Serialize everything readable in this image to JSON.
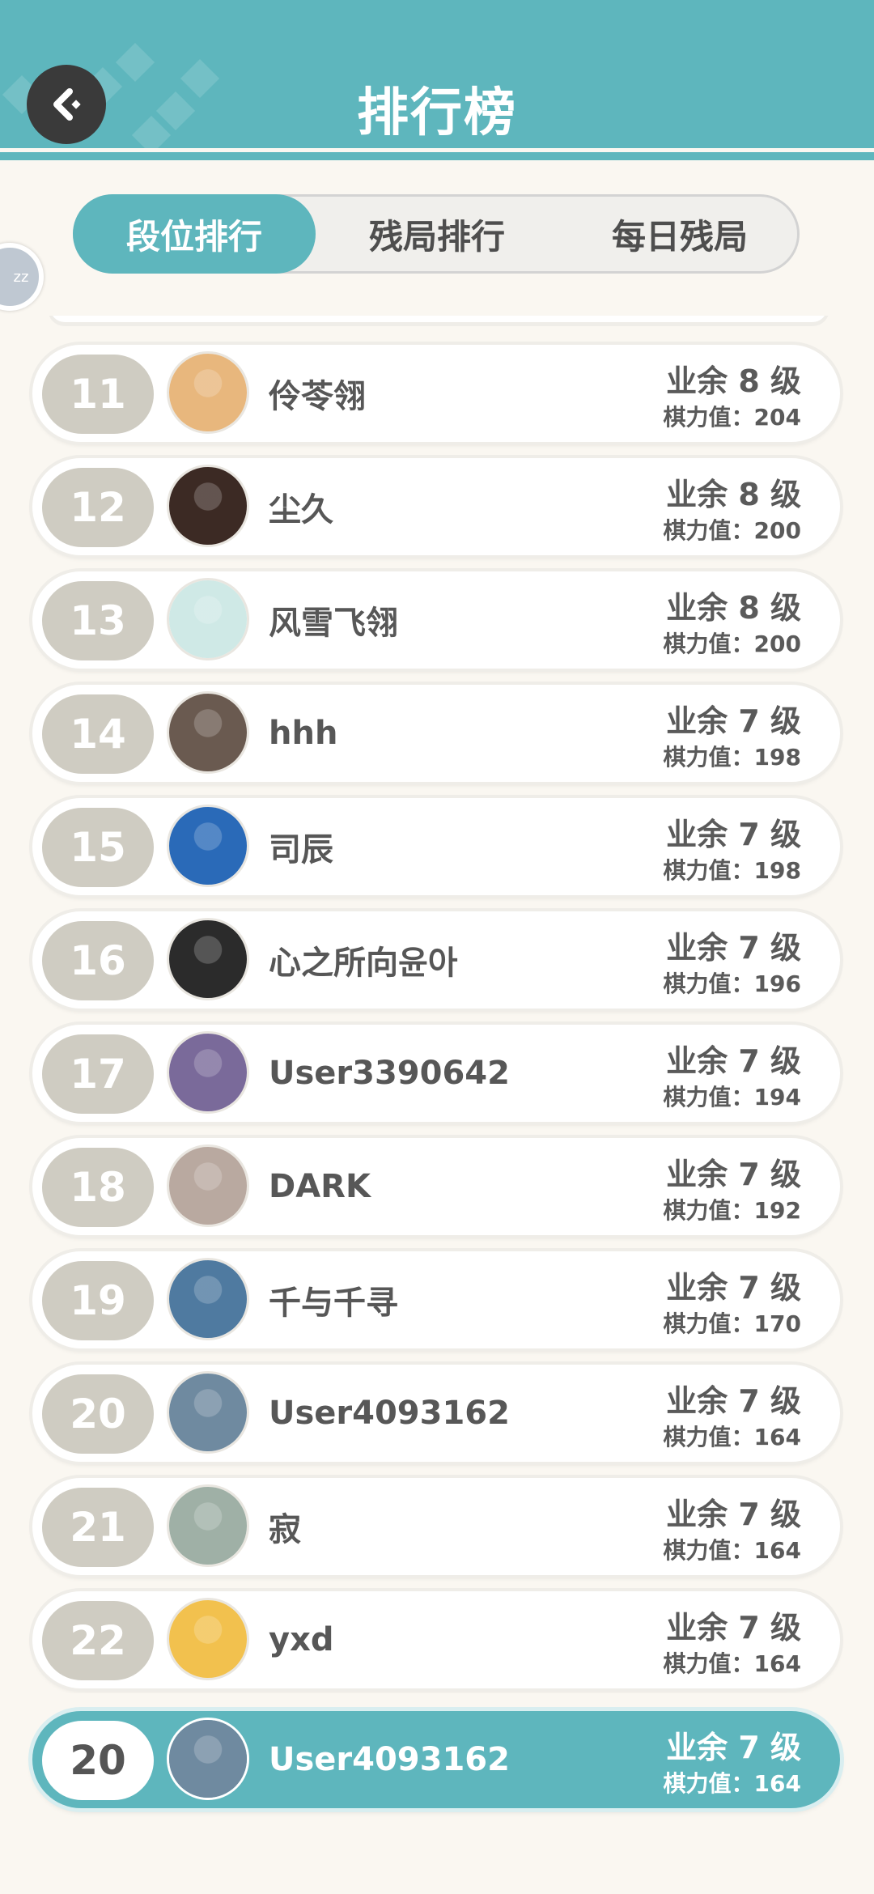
{
  "header": {
    "title": "排行榜"
  },
  "tabs": [
    {
      "label": "段位排行",
      "active": true
    },
    {
      "label": "残局排行",
      "active": false
    },
    {
      "label": "每日残局",
      "active": false
    }
  ],
  "side_bubble": {
    "text": "zz"
  },
  "list": [
    {
      "rank": "11",
      "name": "伶苓翎",
      "level": "业余 8 级",
      "power": "棋力值：204",
      "avatar_color": "#e8b77d"
    },
    {
      "rank": "12",
      "name": "尘久",
      "level": "业余 8 级",
      "power": "棋力值：200",
      "avatar_color": "#3c2a24"
    },
    {
      "rank": "13",
      "name": "风雪飞翎",
      "level": "业余 8 级",
      "power": "棋力值：200",
      "avatar_color": "#cfe9e6"
    },
    {
      "rank": "14",
      "name": "hhh",
      "level": "业余 7 级",
      "power": "棋力值：198",
      "avatar_color": "#6a5a50"
    },
    {
      "rank": "15",
      "name": "司辰",
      "level": "业余 7 级",
      "power": "棋力值：198",
      "avatar_color": "#2a6ab8"
    },
    {
      "rank": "16",
      "name": "心之所向윤아",
      "level": "业余 7 级",
      "power": "棋力值：196",
      "avatar_color": "#2b2b2b"
    },
    {
      "rank": "17",
      "name": "User3390642",
      "level": "业余 7 级",
      "power": "棋力值：194",
      "avatar_color": "#7a6a9a"
    },
    {
      "rank": "18",
      "name": "DARK",
      "level": "业余 7 级",
      "power": "棋力值：192",
      "avatar_color": "#b9a9a0"
    },
    {
      "rank": "19",
      "name": "千与千寻",
      "level": "业余 7 级",
      "power": "棋力值：170",
      "avatar_color": "#4f7aa0"
    },
    {
      "rank": "20",
      "name": "User4093162",
      "level": "业余 7 级",
      "power": "棋力值：164",
      "avatar_color": "#6f8aa0"
    },
    {
      "rank": "21",
      "name": "寂",
      "level": "业余 7 级",
      "power": "棋力值：164",
      "avatar_color": "#9fb0a6"
    },
    {
      "rank": "22",
      "name": "yxd",
      "level": "业余 7 级",
      "power": "棋力值：164",
      "avatar_color": "#f2c14e"
    }
  ],
  "self": {
    "rank": "20",
    "name": "User4093162",
    "level": "业余 7 级",
    "power": "棋力值：164",
    "avatar_color": "#6f8aa0"
  },
  "colors": {
    "accent": "#5eb6bd",
    "rank_badge": "#cfccc2",
    "background": "#faf7f1"
  }
}
